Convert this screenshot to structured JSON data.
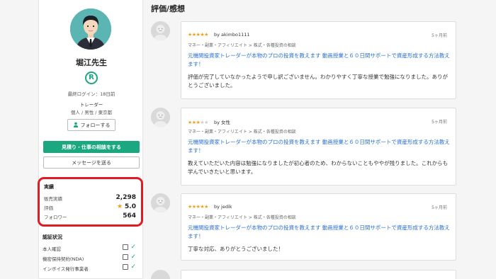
{
  "profile": {
    "name": "堀江先生",
    "rank_badge": "R",
    "last_login": "最終ログイン：18日前",
    "role": "トレーダー",
    "meta": "個人 / 男性 / 東京都",
    "follow_label": "フォローする",
    "consult_label": "見積り・仕事の相談をする",
    "message_label": "メッセージを送る"
  },
  "stats": {
    "title": "実績",
    "sales_label": "販売実績",
    "sales_value": "2,298",
    "rating_label": "評価",
    "rating_value": "5.0",
    "followers_label": "フォロワー",
    "followers_value": "564"
  },
  "verification": {
    "title": "認証状況",
    "items": [
      {
        "label": "本人確認"
      },
      {
        "label": "機密保持契約(NDA)"
      },
      {
        "label": "インボイス発行事業者"
      }
    ]
  },
  "reviews_title": "評価/感想",
  "reviews": [
    {
      "stars": 5,
      "stars_text": "★★★★★",
      "by": "by akimbo1111",
      "time": "5ヶ月前",
      "category": "マネー・副業・アフィリエイト > 株式・各種投資の相談",
      "service_title": "元機関投資家トレーダーが本物のプロの投資を教えます 動画授業と６０日間サポートで資産形成する方法教えます！",
      "comment": "評価が完了していなかったようで申し訳ございません。わかりやすく丁寧な授業で勉強になりました。ありがとうございました。"
    },
    {
      "stars": 3,
      "stars_on": "★★★",
      "stars_off": "★★",
      "by": "by 女性",
      "time": "5ヶ月前",
      "category": "マネー・副業・アフィリエイト > 株式・各種投資の相談",
      "service_title": "元機関投資家トレーダーが本物のプロの投資を教えます 動画授業と６０日間サポートで資産形成する方法教えます！",
      "comment": "教えていただいた内容は勉強になりましたが初心者のため、わからないこともややが残りました。これからも学んでいきたいと思います。"
    },
    {
      "stars": 5,
      "stars_text": "★★★★★",
      "by": "by jedik",
      "time": "5ヶ月前",
      "category": "マネー・副業・アフィリエイト > 株式・各種投資の相談",
      "service_title": "元機関投資家トレーダーが本物のプロの投資を教えます 動画授業と６０日間サポートで資産形成する方法教えます！",
      "comment": "丁寧な対応、ありがとうございました！"
    }
  ]
}
